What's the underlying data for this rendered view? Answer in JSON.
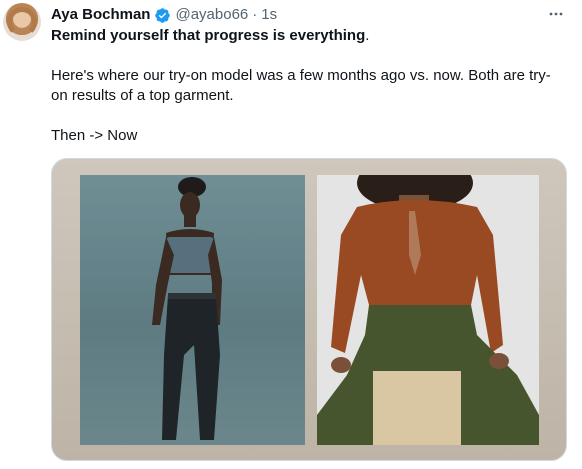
{
  "tweet": {
    "author_name": "Aya Bochman",
    "handle": "@ayabo66",
    "separator": "·",
    "time": "1s",
    "verified_color": "#1d9bf0",
    "line1_bold": "Remind yourself that progress is everything",
    "line1_end": ".",
    "line2": "Here's where our try-on model was a few months ago vs. now. Both are try-on results of a top garment.",
    "line3": "Then -> Now"
  },
  "media": {
    "left_image": "try-on result then",
    "right_image": "try-on result now"
  }
}
